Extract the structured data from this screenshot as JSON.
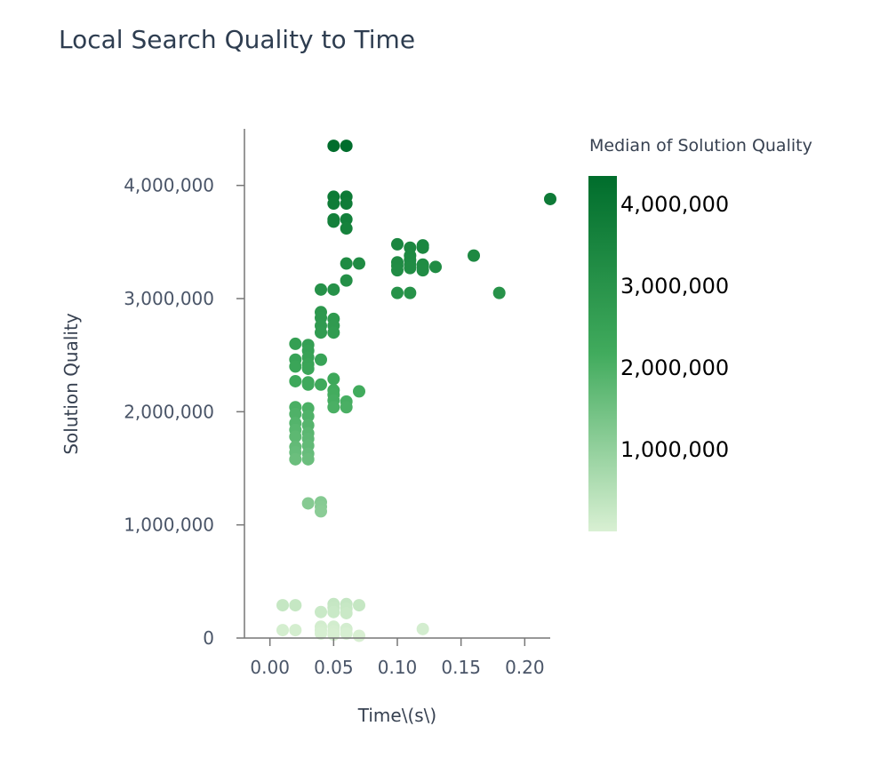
{
  "chart_data": {
    "type": "scatter",
    "title": "Local Search Quality to Time",
    "xlabel": "Time\\(s\\)",
    "ylabel": "Solution Quality",
    "xlim": [
      -0.02,
      0.22
    ],
    "ylim": [
      0,
      4500000
    ],
    "x_ticks": [
      0.0,
      0.05,
      0.1,
      0.15,
      0.2
    ],
    "x_tick_labels": [
      "0.00",
      "0.05",
      "0.10",
      "0.15",
      "0.20"
    ],
    "y_ticks": [
      0,
      1000000,
      2000000,
      3000000,
      4000000
    ],
    "y_tick_labels": [
      "0",
      "1,000,000",
      "2,000,000",
      "3,000,000",
      "4,000,000"
    ],
    "color_legend": {
      "title": "Median of Solution Quality",
      "min": 0,
      "max": 4350000,
      "ticks": [
        1000000,
        2000000,
        3000000,
        4000000
      ],
      "tick_labels": [
        "1,000,000",
        "2,000,000",
        "3,000,000",
        "4,000,000"
      ],
      "color_low": "#d9f0d3",
      "color_mid": "#41ab5d",
      "color_high": "#006d2c"
    },
    "points": [
      [
        0.05,
        4350000
      ],
      [
        0.06,
        4350000
      ],
      [
        0.05,
        3900000
      ],
      [
        0.06,
        3900000
      ],
      [
        0.05,
        3840000
      ],
      [
        0.06,
        3840000
      ],
      [
        0.05,
        3700000
      ],
      [
        0.05,
        3680000
      ],
      [
        0.06,
        3700000
      ],
      [
        0.06,
        3620000
      ],
      [
        0.06,
        3310000
      ],
      [
        0.07,
        3310000
      ],
      [
        0.06,
        3160000
      ],
      [
        0.22,
        3880000
      ],
      [
        0.04,
        3080000
      ],
      [
        0.05,
        3080000
      ],
      [
        0.04,
        2880000
      ],
      [
        0.04,
        2830000
      ],
      [
        0.05,
        2820000
      ],
      [
        0.04,
        2760000
      ],
      [
        0.05,
        2760000
      ],
      [
        0.04,
        2700000
      ],
      [
        0.05,
        2700000
      ],
      [
        0.1,
        3480000
      ],
      [
        0.11,
        3450000
      ],
      [
        0.12,
        3470000
      ],
      [
        0.12,
        3450000
      ],
      [
        0.11,
        3380000
      ],
      [
        0.11,
        3340000
      ],
      [
        0.1,
        3320000
      ],
      [
        0.1,
        3290000
      ],
      [
        0.11,
        3300000
      ],
      [
        0.12,
        3300000
      ],
      [
        0.12,
        3280000
      ],
      [
        0.1,
        3250000
      ],
      [
        0.11,
        3270000
      ],
      [
        0.12,
        3250000
      ],
      [
        0.13,
        3280000
      ],
      [
        0.16,
        3380000
      ],
      [
        0.1,
        3050000
      ],
      [
        0.11,
        3050000
      ],
      [
        0.18,
        3050000
      ],
      [
        0.02,
        2600000
      ],
      [
        0.03,
        2590000
      ],
      [
        0.03,
        2540000
      ],
      [
        0.02,
        2460000
      ],
      [
        0.03,
        2480000
      ],
      [
        0.04,
        2460000
      ],
      [
        0.02,
        2400000
      ],
      [
        0.03,
        2420000
      ],
      [
        0.03,
        2380000
      ],
      [
        0.05,
        2290000
      ],
      [
        0.02,
        2270000
      ],
      [
        0.03,
        2260000
      ],
      [
        0.03,
        2240000
      ],
      [
        0.04,
        2240000
      ],
      [
        0.05,
        2190000
      ],
      [
        0.05,
        2150000
      ],
      [
        0.07,
        2180000
      ],
      [
        0.05,
        2100000
      ],
      [
        0.06,
        2090000
      ],
      [
        0.05,
        2040000
      ],
      [
        0.06,
        2040000
      ],
      [
        0.02,
        2040000
      ],
      [
        0.03,
        2030000
      ],
      [
        0.02,
        1980000
      ],
      [
        0.03,
        1960000
      ],
      [
        0.02,
        1900000
      ],
      [
        0.03,
        1880000
      ],
      [
        0.02,
        1840000
      ],
      [
        0.03,
        1810000
      ],
      [
        0.02,
        1780000
      ],
      [
        0.03,
        1760000
      ],
      [
        0.02,
        1690000
      ],
      [
        0.03,
        1700000
      ],
      [
        0.02,
        1640000
      ],
      [
        0.03,
        1630000
      ],
      [
        0.02,
        1580000
      ],
      [
        0.03,
        1580000
      ],
      [
        0.03,
        1190000
      ],
      [
        0.04,
        1200000
      ],
      [
        0.04,
        1160000
      ],
      [
        0.04,
        1120000
      ],
      [
        0.01,
        290000
      ],
      [
        0.02,
        290000
      ],
      [
        0.04,
        230000
      ],
      [
        0.05,
        300000
      ],
      [
        0.05,
        270000
      ],
      [
        0.05,
        230000
      ],
      [
        0.06,
        300000
      ],
      [
        0.06,
        260000
      ],
      [
        0.06,
        220000
      ],
      [
        0.07,
        290000
      ],
      [
        0.01,
        70000
      ],
      [
        0.02,
        70000
      ],
      [
        0.04,
        100000
      ],
      [
        0.04,
        70000
      ],
      [
        0.04,
        40000
      ],
      [
        0.05,
        100000
      ],
      [
        0.05,
        60000
      ],
      [
        0.05,
        30000
      ],
      [
        0.06,
        80000
      ],
      [
        0.06,
        40000
      ],
      [
        0.07,
        20000
      ],
      [
        0.12,
        80000
      ]
    ]
  }
}
